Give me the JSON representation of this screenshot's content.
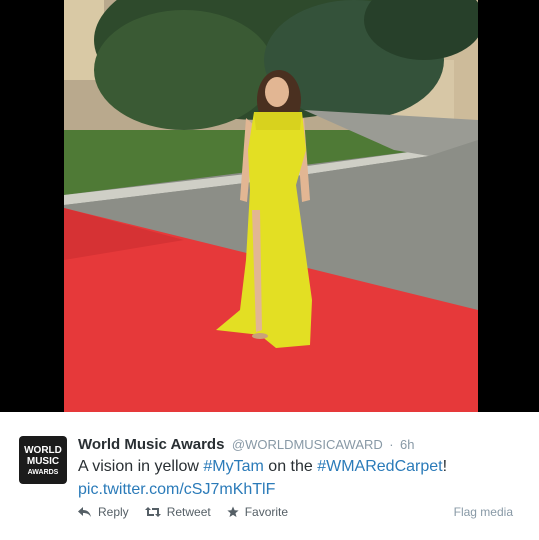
{
  "media": {
    "description_hidden": ""
  },
  "tweet": {
    "avatar_lines": [
      "WORLD",
      "MUSIC",
      "AWARDS"
    ],
    "full_name": "World Music Awards",
    "handle": "@WORLDMUSICAWARD",
    "separator": "·",
    "time": "6h",
    "text_parts": {
      "t1": "A vision in yellow ",
      "h1": "#MyTam",
      "t2": " on the ",
      "h2": "#WMARedCarpet",
      "t3": "!"
    },
    "link": "pic.twitter.com/cSJ7mKhTlF"
  },
  "actions": {
    "reply": "Reply",
    "retweet": "Retweet",
    "favorite": "Favorite",
    "flag": "Flag media"
  },
  "colors": {
    "link": "#2b7bb9",
    "muted": "#8899a6",
    "carpet": "#e8393a",
    "dress": "#e6e02a"
  }
}
